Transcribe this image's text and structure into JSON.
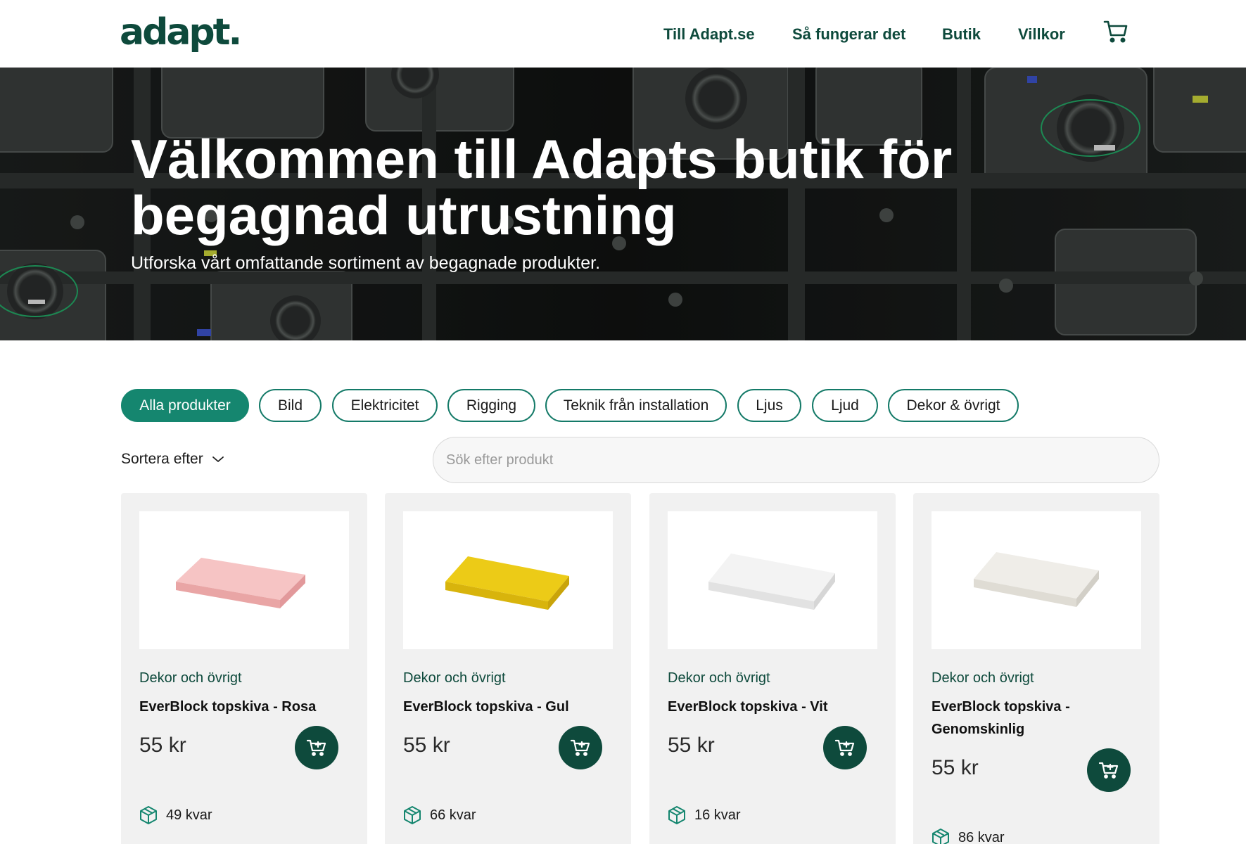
{
  "brand": {
    "logo_text": "adapt."
  },
  "nav": {
    "links": [
      "Till Adapt.se",
      "Så fungerar det",
      "Butik",
      "Villkor"
    ],
    "cart_icon": "cart-icon"
  },
  "hero": {
    "title": "Välkommen till Adapts butik för begagnad utrustning",
    "subtitle": "Utforska vårt omfattande sortiment av begagnade produkter."
  },
  "filters": {
    "chips": [
      "Alla produkter",
      "Bild",
      "Elektricitet",
      "Rigging",
      "Teknik från installation",
      "Ljus",
      "Ljud",
      "Dekor & övrigt"
    ],
    "active": "Alla produkter"
  },
  "sort": {
    "label": "Sortera efter",
    "icon": "chevron-down-icon"
  },
  "search": {
    "placeholder": "Sök efter produkt",
    "value": ""
  },
  "products": [
    {
      "category": "Dekor och övrigt",
      "name": "EverBlock topskiva - Rosa",
      "price": "55 kr",
      "stock": "49 kvar",
      "color": "#f2b3b3"
    },
    {
      "category": "Dekor och övrigt",
      "name": "EverBlock topskiva - Gul",
      "price": "55 kr",
      "stock": "66 kvar",
      "color": "#e8c51a"
    },
    {
      "category": "Dekor och övrigt",
      "name": "EverBlock topskiva - Vit",
      "price": "55 kr",
      "stock": "16 kvar",
      "color": "#ececec"
    },
    {
      "category": "Dekor och övrigt",
      "name": "EverBlock topskiva - Genomskinlig",
      "price": "55 kr",
      "stock": "86 kvar",
      "color": "#ebe9e4"
    }
  ],
  "colors": {
    "brand_dark": "#0e4a3c",
    "brand_teal": "#15866f"
  }
}
